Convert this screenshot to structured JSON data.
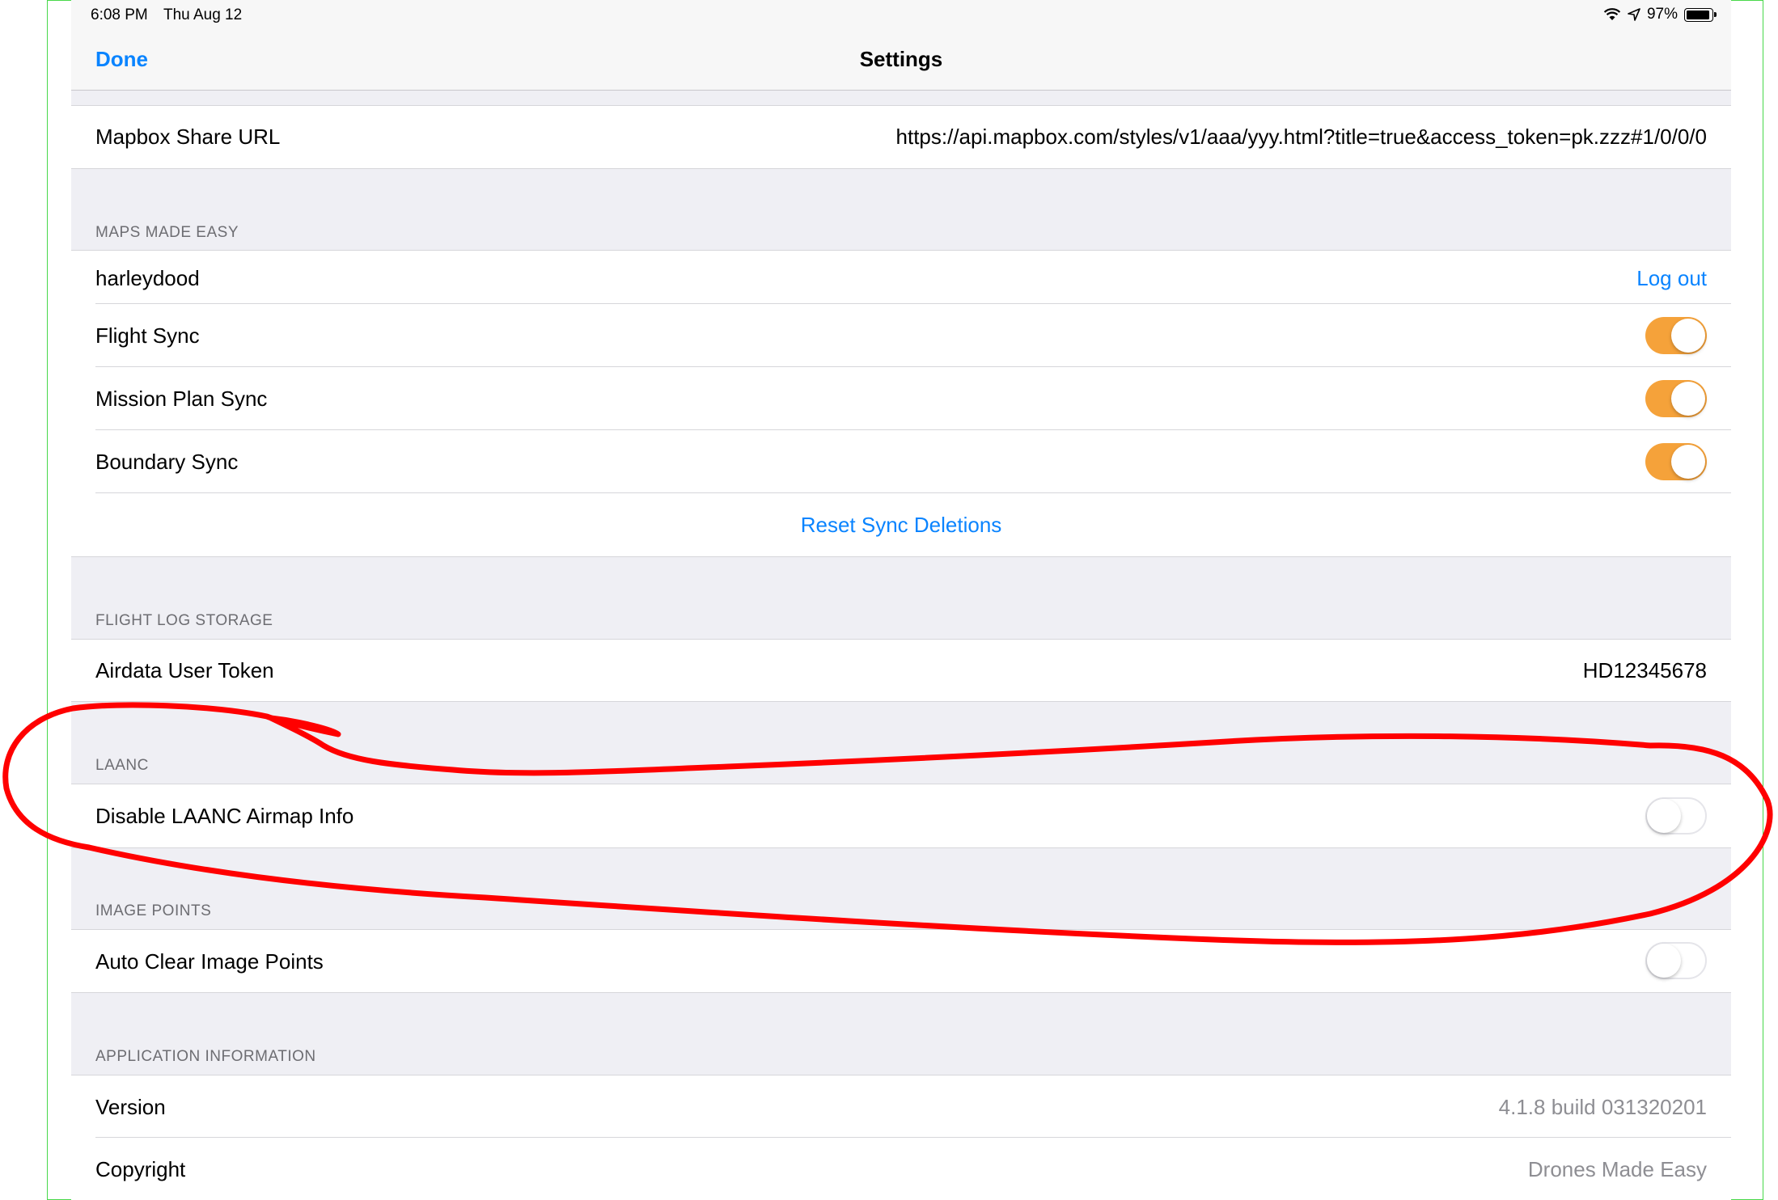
{
  "status_bar": {
    "time": "6:08 PM",
    "date": "Thu Aug 12",
    "battery": "97%"
  },
  "nav": {
    "done_label": "Done",
    "title": "Settings"
  },
  "mapbox": {
    "label": "Mapbox Share URL",
    "value": "https://api.mapbox.com/styles/v1/aaa/yyy.html?title=true&access_token=pk.zzz#1/0/0/0"
  },
  "maps_made_easy": {
    "header": "MAPS MADE EASY",
    "username": "harleydood",
    "logout_label": "Log out",
    "flight_sync": {
      "label": "Flight Sync",
      "on": true
    },
    "mission_plan_sync": {
      "label": "Mission Plan Sync",
      "on": true
    },
    "boundary_sync": {
      "label": "Boundary Sync",
      "on": true
    },
    "reset_label": "Reset Sync Deletions"
  },
  "flight_log_storage": {
    "header": "FLIGHT LOG STORAGE",
    "token_label": "Airdata User Token",
    "token_value": "HD12345678"
  },
  "laanc": {
    "header": "LAANC",
    "disable_label": "Disable LAANC Airmap Info",
    "on": false
  },
  "image_points": {
    "header": "IMAGE POINTS",
    "auto_clear_label": "Auto Clear Image Points",
    "on": false
  },
  "app_info": {
    "header": "APPLICATION INFORMATION",
    "version_label": "Version",
    "version_value": "4.1.8 build 031320201",
    "copyright_label": "Copyright",
    "copyright_value": "Drones Made Easy"
  },
  "colors": {
    "accent": "#0a84ff",
    "toggle_on": "#f5a23a",
    "annotation": "#ff0000",
    "frame": "#48d84a"
  }
}
